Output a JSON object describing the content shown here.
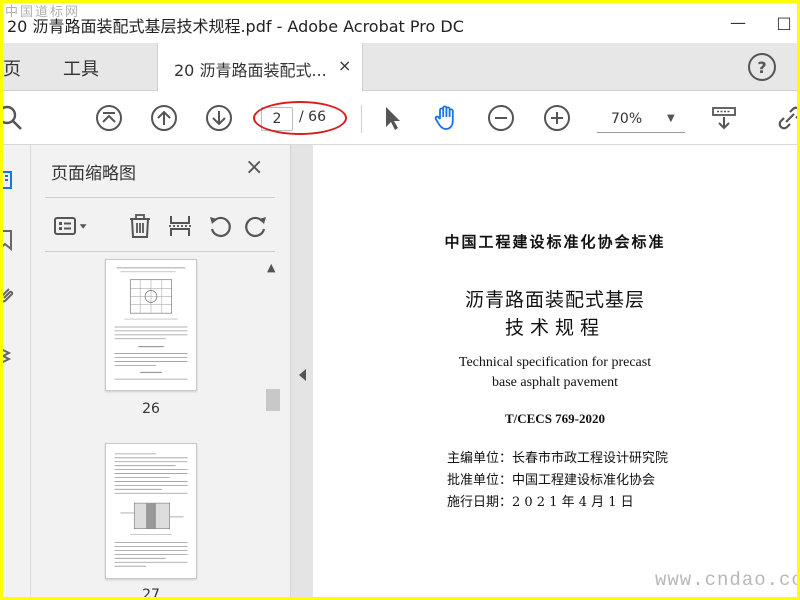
{
  "watermark_top": "中国道标网",
  "watermark_bottom": "www.cndao.com",
  "window": {
    "title": "20 沥青路面装配式基层技术规程.pdf - Adobe Acrobat Pro DC",
    "minimize_icon": "minimize-icon",
    "restore_icon": "restore-icon"
  },
  "menu": {
    "home": "主页",
    "tools": "工具"
  },
  "tab": {
    "label": "20 沥青路面装配式...",
    "close": "×"
  },
  "help": "?",
  "toolbar": {
    "current_page": "2",
    "total_pages": "/ 66",
    "zoom": "70%",
    "highlight_color": "#d81e1e",
    "active_color": "#1a73e8"
  },
  "thumbnails_panel": {
    "title": "页面缩略图",
    "close": "×",
    "pages": [
      {
        "number": "26"
      },
      {
        "number": "27"
      }
    ]
  },
  "document": {
    "org_header": "中国工程建设标准化协会标准",
    "title_line1": "沥青路面装配式基层",
    "title_line2": "技术规程",
    "en_line1": "Technical specification for precast",
    "en_line2": "base asphalt pavement",
    "standard_no": "T/CECS 769-2020",
    "editor_unit": "主编单位：长春市市政工程设计研究院",
    "approval_unit": "批准单位：中国工程建设标准化协会",
    "effective_date": "施行日期：2 0 2 1 年 4 月 1 日"
  }
}
